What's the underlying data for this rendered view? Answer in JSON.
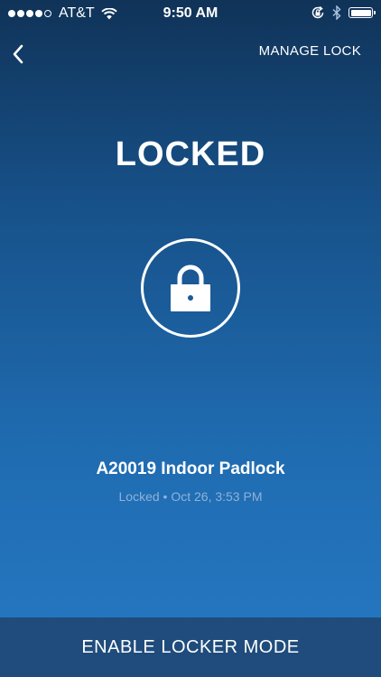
{
  "status_bar": {
    "carrier": "AT&T",
    "time": "9:50 AM",
    "signal_icon": "signal-dots-icon",
    "wifi_icon": "wifi-icon",
    "rotation_lock_icon": "rotation-lock-icon",
    "bluetooth_icon": "bluetooth-icon",
    "battery_icon": "battery-icon"
  },
  "nav": {
    "back_icon": "chevron-left-icon",
    "manage_lock_label": "MANAGE LOCK"
  },
  "lock": {
    "state_title": "LOCKED",
    "icon": "padlock-icon",
    "device_name": "A20019 Indoor Padlock",
    "status_text": "Locked • Oct 26, 3:53 PM"
  },
  "footer": {
    "enable_locker_mode_label": "ENABLE LOCKER MODE"
  },
  "colors": {
    "gradient_top": "#103358",
    "gradient_bottom": "#2679c4",
    "footer_bg": "#1f4c7c",
    "secondary_text": "#8fb2d8"
  }
}
